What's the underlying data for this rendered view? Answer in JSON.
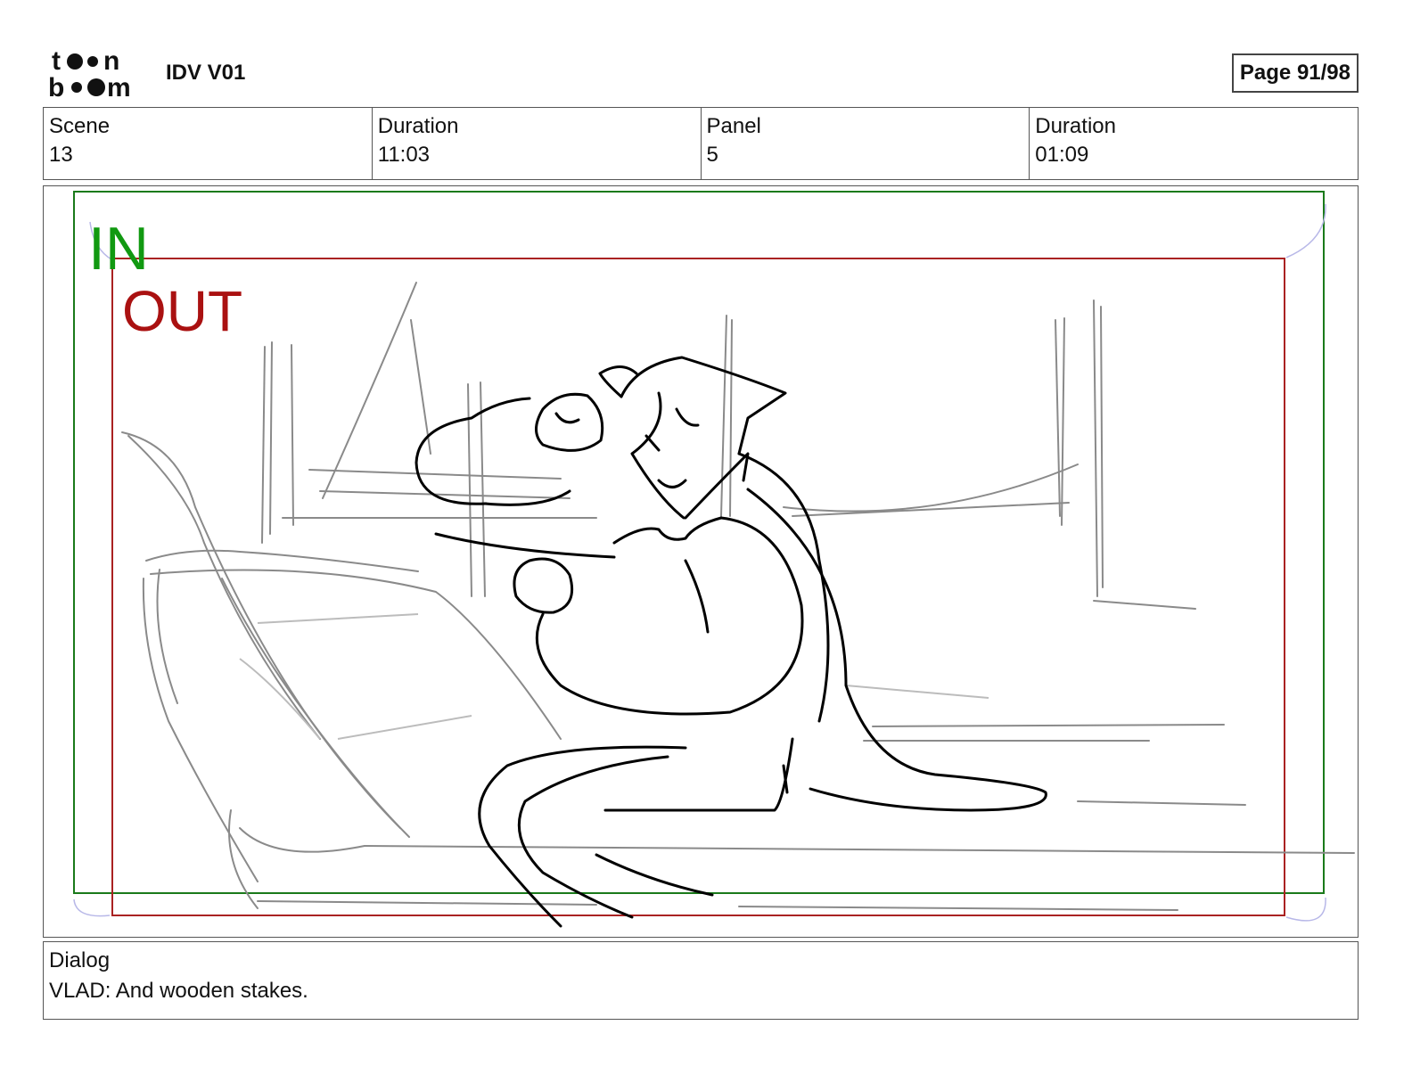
{
  "header": {
    "logo_text": "toon boom",
    "project_title": "IDV V01",
    "page_label": "Page 91/98"
  },
  "info": {
    "scene_label": "Scene",
    "scene_value": "13",
    "scene_duration_label": "Duration",
    "scene_duration_value": "11:03",
    "panel_label": "Panel",
    "panel_value": "5",
    "panel_duration_label": "Duration",
    "panel_duration_value": "01:09"
  },
  "panel": {
    "in_label": "IN",
    "out_label": "OUT",
    "in_color": "#119911",
    "out_color": "#aa1111"
  },
  "dialog": {
    "label": "Dialog",
    "text": "VLAD: And wooden stakes."
  }
}
